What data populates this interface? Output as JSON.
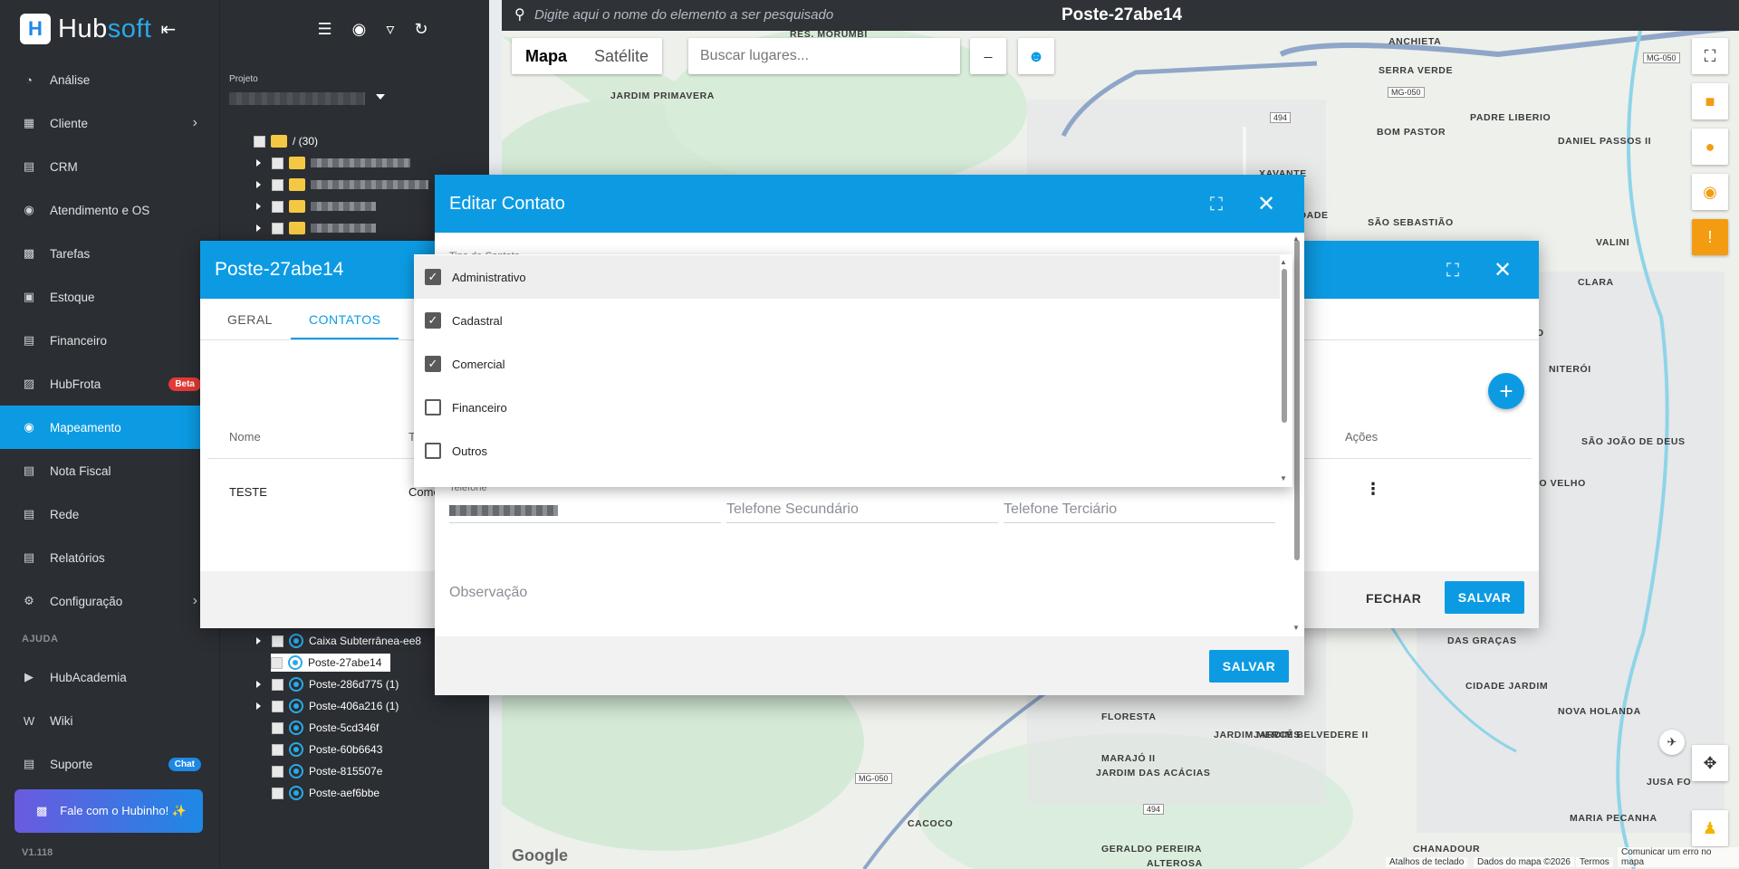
{
  "app": {
    "logo_text_a": "Hub",
    "logo_text_b": "soft",
    "version": "V1.118"
  },
  "sidebar": {
    "items": [
      {
        "label": "Análise",
        "icon": "pie-chart-icon",
        "chev": false
      },
      {
        "label": "Cliente",
        "icon": "id-card-icon",
        "chev": true
      },
      {
        "label": "CRM",
        "icon": "crm-icon",
        "chev": false
      },
      {
        "label": "Atendimento e OS",
        "icon": "headset-icon",
        "chev": false
      },
      {
        "label": "Tarefas",
        "icon": "calendar-icon",
        "chev": false
      },
      {
        "label": "Estoque",
        "icon": "box-icon",
        "chev": false
      },
      {
        "label": "Financeiro",
        "icon": "money-icon",
        "chev": false
      },
      {
        "label": "HubFrota",
        "icon": "car-icon",
        "chev": false,
        "badge": "Beta"
      },
      {
        "label": "Mapeamento",
        "icon": "map-pin-icon",
        "chev": false,
        "active": true
      },
      {
        "label": "Nota Fiscal",
        "icon": "invoice-icon",
        "chev": false
      },
      {
        "label": "Rede",
        "icon": "network-icon",
        "chev": false
      },
      {
        "label": "Relatórios",
        "icon": "report-icon",
        "chev": false
      },
      {
        "label": "Configuração",
        "icon": "gear-icon",
        "chev": true
      }
    ],
    "help_label": "AJUDA",
    "help_items": [
      {
        "label": "HubAcademia",
        "icon": "youtube-icon"
      },
      {
        "label": "Wiki",
        "icon": "wiki-icon"
      },
      {
        "label": "Suporte",
        "icon": "support-icon",
        "badge": "Chat"
      }
    ],
    "hubinho_label": "Fale com o Hubinho! ✨"
  },
  "project": {
    "label": "Projeto",
    "root_folder": "/ (30)",
    "items": [
      {
        "label": "Caixa Subterrânea-ee8",
        "expandable": true
      },
      {
        "label": "Poste-27abe14",
        "expandable": false,
        "selected": true
      },
      {
        "label": "Poste-286d775 (1)",
        "expandable": true
      },
      {
        "label": "Poste-406a216 (1)",
        "expandable": true
      },
      {
        "label": "Poste-5cd346f",
        "expandable": false
      },
      {
        "label": "Poste-60b6643",
        "expandable": false
      },
      {
        "label": "Poste-815507e",
        "expandable": false
      },
      {
        "label": "Poste-aef6bbe",
        "expandable": false
      }
    ]
  },
  "map": {
    "search_placeholder": "Digite aqui o nome do elemento a ser pesquisado",
    "title": "Poste-27abe14",
    "type_map": "Mapa",
    "type_satellite": "Satélite",
    "places_placeholder": "Buscar lugares...",
    "labels": [
      "ANCHIETA",
      "SERRA VERDE",
      "JARDIM PRIMAVERA",
      "RES. MORUMBI",
      "XAVANTE",
      "BOM PASTOR",
      "PADRE LIBERIO",
      "DANIEL PASSOS II",
      "LIBERDADE",
      "SÃO SEBASTIÃO",
      "CLARA",
      "VALINI",
      "ESPIRITO SANTO",
      "NITERÓI",
      "SÃO JOÃO DE DEUS",
      "PORTO VELHO",
      "DAS GRAÇAS",
      "CIDADE JARDIM",
      "NOVA HOLANDA",
      "FLORESTA",
      "JARDIM MERCÊS",
      "JARDIM BELVEDERE II",
      "MARAJÓ II",
      "JARDIM DAS ACÁCIAS",
      "JUSA FO",
      "CACOCO",
      "CHANADOUR",
      "MARIA PECANHA",
      "GERALDO PEREIRA",
      "ALTEROSA"
    ],
    "roads": [
      "MG-050",
      "MG-050",
      "494",
      "MG-050",
      "494"
    ],
    "footer_keyboard": "Atalhos de teclado",
    "footer_data": "Dados do mapa ©2026",
    "footer_terms": "Termos",
    "footer_report": "Comunicar um erro no mapa",
    "google": "Google"
  },
  "poste_modal": {
    "title": "Poste-27abe14",
    "tabs": [
      "GERAL",
      "CONTATOS"
    ],
    "columns": {
      "nome": "Nome",
      "tipo": "T",
      "acoes": "Ações"
    },
    "row": {
      "nome": "TESTE",
      "tipo": "Come"
    },
    "close_label": "FECHAR",
    "save_label": "SALVAR"
  },
  "editar_modal": {
    "title": "Editar Contato",
    "type_label": "Tipo de Contato",
    "phone_label": "Telefone",
    "phone2_placeholder": "Telefone Secundário",
    "phone3_placeholder": "Telefone Terciário",
    "obs_placeholder": "Observação",
    "save_label": "SALVAR"
  },
  "dropdown": {
    "options": [
      {
        "label": "Administrativo",
        "checked": true
      },
      {
        "label": "Cadastral",
        "checked": true
      },
      {
        "label": "Comercial",
        "checked": true
      },
      {
        "label": "Financeiro",
        "checked": false
      },
      {
        "label": "Outros",
        "checked": false
      }
    ]
  },
  "colors": {
    "accent": "#0c9be3",
    "sidebar": "#2b2e33",
    "active_item": "#0c9be3"
  }
}
